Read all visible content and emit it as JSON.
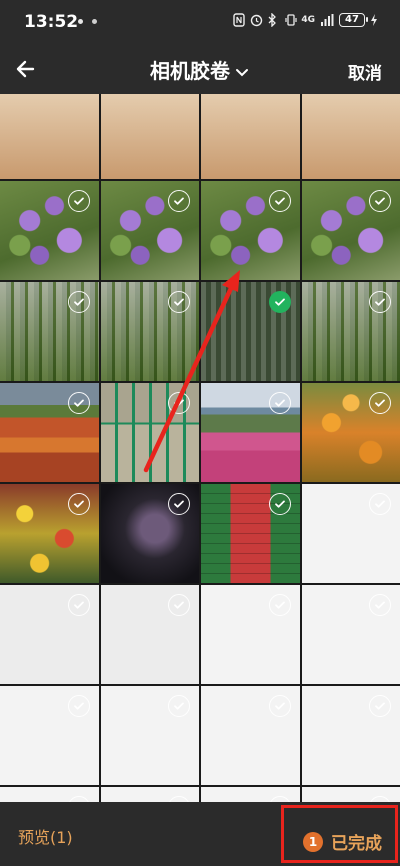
{
  "status_bar": {
    "time": "13:52",
    "network": "4G",
    "battery": "47"
  },
  "header": {
    "title": "相机胶卷",
    "cancel_label": "取消"
  },
  "grid": {
    "rows": [
      [
        "top-strip",
        "top-strip",
        "top-strip",
        "top-strip"
      ],
      [
        "flower-purple",
        "flower-purple",
        "flower-purple",
        "flower-purple"
      ],
      [
        "flower-white",
        "flower-white",
        "flower-dark",
        "flower-white"
      ],
      [
        "field-red",
        "fence",
        "field-pink",
        "field-orange"
      ],
      [
        "field-yellow",
        "dark-photo",
        "doc-green",
        "sketch-light"
      ],
      [
        "sketch",
        "sketch",
        "sketch-light",
        "sketch-light"
      ],
      [
        "sketch-light",
        "sketch-light",
        "sketch-light",
        "sketch-light"
      ],
      [
        "sketch-light",
        "sketch-light",
        "sketch-light",
        "sketch-light"
      ]
    ],
    "selected": [
      [
        2,
        2
      ]
    ]
  },
  "bottom_bar": {
    "preview_label": "预览(1)",
    "done_count": "1",
    "done_label": "已完成"
  },
  "colors": {
    "accent": "#e7a35a",
    "selected_check": "#22b35e",
    "highlight_box": "#e8241d",
    "arrow": "#e8241d"
  }
}
